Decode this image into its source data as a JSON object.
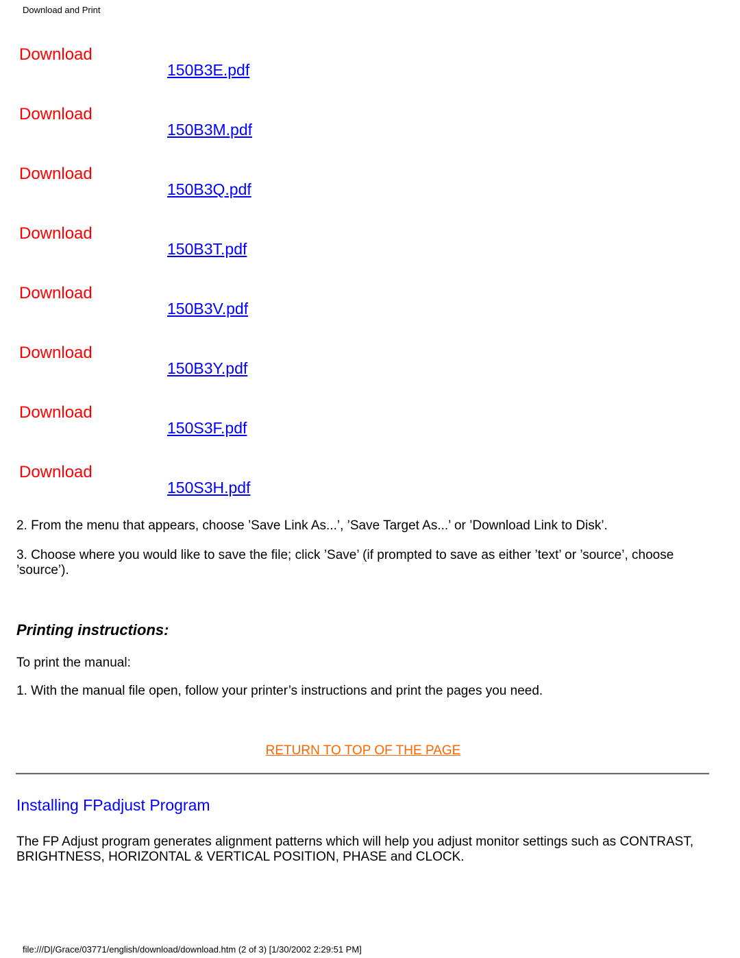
{
  "header": {
    "title": "Download and Print"
  },
  "downloads": [
    {
      "label": "Download",
      "file": "150B3E.pdf"
    },
    {
      "label": "Download",
      "file": "150B3M.pdf"
    },
    {
      "label": "Download",
      "file": "150B3Q.pdf"
    },
    {
      "label": "Download",
      "file": "150B3T.pdf"
    },
    {
      "label": "Download",
      "file": "150B3V.pdf"
    },
    {
      "label": "Download",
      "file": "150B3Y.pdf"
    },
    {
      "label": "Download",
      "file": "150S3F.pdf"
    },
    {
      "label": "Download",
      "file": "150S3H.pdf"
    }
  ],
  "steps": {
    "step2": "2. From the menu that appears, choose ’Save Link As...’, ’Save Target As...’ or ’Download Link to Disk’.",
    "step3": "3. Choose where you would like to save the file; click ’Save’ (if prompted to save as either ’text’ or ’source’, choose ’source’)."
  },
  "printing": {
    "heading": "Printing instructions:",
    "intro": "To print the manual:",
    "step1": "1. With the manual file open, follow your printer’s instructions and print the pages you need."
  },
  "return_link": "RETURN TO TOP OF THE PAGE",
  "installing": {
    "heading": "Installing FPadjust Program",
    "body": "The FP Adjust program generates alignment patterns which will help you adjust monitor settings such as CONTRAST, BRIGHTNESS, HORIZONTAL & VERTICAL POSITION, PHASE and CLOCK."
  },
  "footer": {
    "text": "file:///D|/Grace/03771/english/download/download.htm (2 of 3) [1/30/2002 2:29:51 PM]"
  },
  "colors": {
    "download_label": "#ff0000",
    "pdf_link": "#0000ff",
    "return_link": "#ff6600",
    "section_heading": "#0000ff"
  }
}
